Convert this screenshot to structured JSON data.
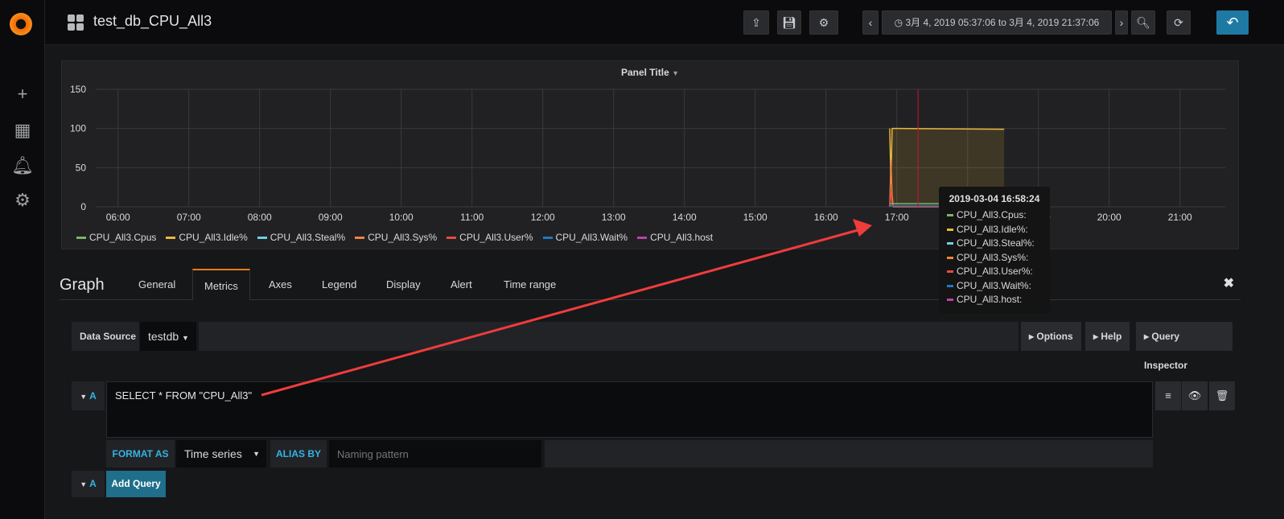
{
  "topbar": {
    "title": "test_db_CPU_All3",
    "time_range": "3月 4, 2019 05:37:06 to 3月 4, 2019 21:37:06"
  },
  "panel": {
    "title": "Panel Title",
    "legend": [
      {
        "label": "CPU_All3.Cpus",
        "color": "#7eb26d"
      },
      {
        "label": "CPU_All3.Idle%",
        "color": "#eab839"
      },
      {
        "label": "CPU_All3.Steal%",
        "color": "#6ed0e0"
      },
      {
        "label": "CPU_All3.Sys%",
        "color": "#ef843c"
      },
      {
        "label": "CPU_All3.User%",
        "color": "#e24d42"
      },
      {
        "label": "CPU_All3.Wait%",
        "color": "#1f78c1"
      },
      {
        "label": "CPU_All3.host",
        "color": "#ba43a9"
      }
    ]
  },
  "chart_data": {
    "type": "line",
    "ylim": [
      0,
      150
    ],
    "y_ticks": [
      "0",
      "50",
      "100",
      "150"
    ],
    "x_ticks": [
      "06:00",
      "07:00",
      "08:00",
      "09:00",
      "10:00",
      "11:00",
      "12:00",
      "13:00",
      "14:00",
      "15:00",
      "16:00",
      "17:00",
      "18:00",
      "19:00",
      "20:00",
      "21:00"
    ],
    "x_range": [
      "05:37",
      "21:37"
    ],
    "grid": true,
    "marker_time": "17:18",
    "series": [
      {
        "name": "CPU_All3.Idle%",
        "color": "#eab839",
        "fill": true,
        "points": [
          [
            "16:54",
            100
          ],
          [
            "16:55",
            30
          ],
          [
            "16:56",
            100
          ],
          [
            "17:00",
            100
          ],
          [
            "18:31",
            99
          ]
        ]
      },
      {
        "name": "CPU_All3.Sys%",
        "color": "#ef843c",
        "points": [
          [
            "16:54",
            0
          ],
          [
            "16:55",
            60
          ],
          [
            "16:56",
            15
          ],
          [
            "16:57",
            0
          ],
          [
            "18:31",
            0
          ]
        ]
      },
      {
        "name": "CPU_All3.User%",
        "color": "#e24d42",
        "points": [
          [
            "16:54",
            0
          ],
          [
            "16:55",
            20
          ],
          [
            "16:56",
            5
          ],
          [
            "16:57",
            0
          ],
          [
            "18:31",
            0
          ]
        ]
      },
      {
        "name": "CPU_All3.Cpus",
        "color": "#7eb26d",
        "points": [
          [
            "16:54",
            4
          ],
          [
            "18:31",
            4
          ]
        ]
      },
      {
        "name": "CPU_All3.Wait%",
        "color": "#1f78c1",
        "points": [
          [
            "16:54",
            1
          ],
          [
            "18:31",
            1
          ]
        ]
      }
    ]
  },
  "tooltip": {
    "time": "2019-03-04 16:58:24",
    "rows": [
      "CPU_All3.Cpus:",
      "CPU_All3.Idle%:",
      "CPU_All3.Steal%:",
      "CPU_All3.Sys%:",
      "CPU_All3.User%:",
      "CPU_All3.Wait%:",
      "CPU_All3.host:"
    ]
  },
  "editor": {
    "title": "Graph",
    "tabs": [
      "General",
      "Metrics",
      "Axes",
      "Legend",
      "Display",
      "Alert",
      "Time range"
    ],
    "active_tab": "Metrics",
    "datasource_label": "Data Source",
    "datasource": "testdb",
    "options": "Options",
    "help": "Help",
    "inspector": "Query Inspector",
    "query_ref": "A",
    "query": "SELECT * FROM \"CPU_All3\"",
    "format_as_label": "FORMAT AS",
    "format_as": "Time series",
    "alias_label": "ALIAS BY",
    "alias_placeholder": "Naming pattern",
    "add_query": "Add Query"
  }
}
